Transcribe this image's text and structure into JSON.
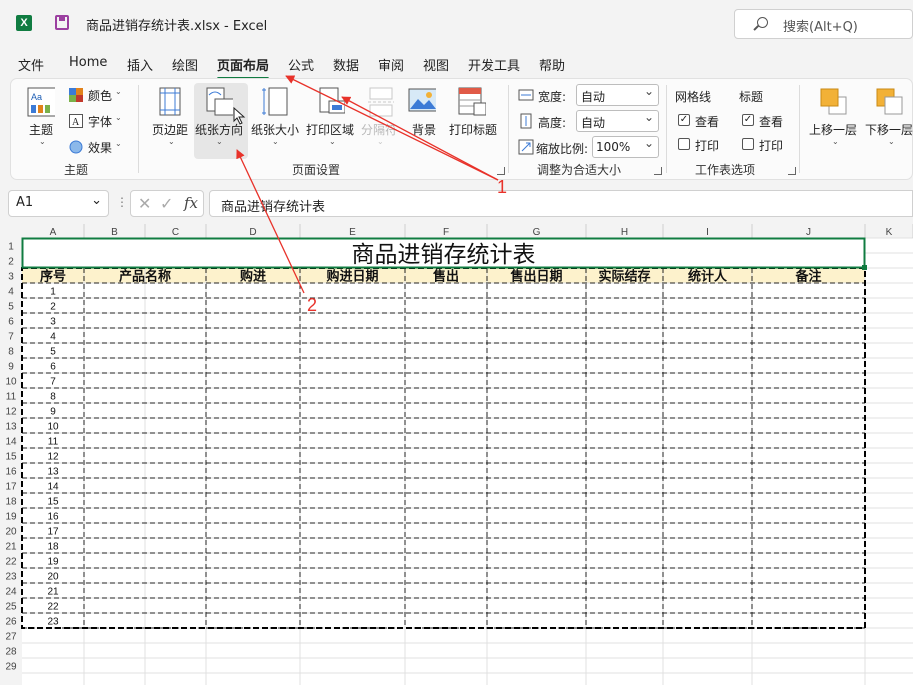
{
  "window": {
    "title": "商品进销存统计表.xlsx  -  Excel"
  },
  "search": {
    "placeholder": "搜索(Alt+Q)"
  },
  "menu": {
    "tabs": [
      "文件",
      "Home",
      "插入",
      "绘图",
      "页面布局",
      "公式",
      "数据",
      "审阅",
      "视图",
      "开发工具",
      "帮助"
    ],
    "active": "页面布局"
  },
  "ribbon": {
    "theme": {
      "themes": "主题",
      "colors": "颜色",
      "fonts": "字体",
      "effects": "效果",
      "group": "主题"
    },
    "page_setup": {
      "margins": "页边距",
      "orientation": "纸张方向",
      "size": "纸张大小",
      "print_area": "打印区域",
      "breaks": "分隔符",
      "background": "背景",
      "print_titles": "打印标题",
      "group": "页面设置"
    },
    "scale": {
      "width_label": "宽度:",
      "width_value": "自动",
      "height_label": "高度:",
      "height_value": "自动",
      "scale_label": "缩放比例:",
      "scale_value": "100%",
      "group": "调整为合适大小"
    },
    "sheet_options": {
      "gridlines": "网格线",
      "headings": "标题",
      "view": "查看",
      "print": "打印",
      "gridlines_view": true,
      "gridlines_print": false,
      "headings_view": true,
      "headings_print": false,
      "group": "工作表选项"
    },
    "arrange": {
      "bring_forward": "上移一层",
      "send_backward": "下移一层"
    }
  },
  "formula_bar": {
    "name_box": "A1",
    "fx": "fx",
    "content": "商品进销存统计表"
  },
  "sheet": {
    "columns": [
      "A",
      "B",
      "C",
      "D",
      "E",
      "F",
      "G",
      "H",
      "I",
      "J",
      "K"
    ],
    "rows": [
      "1",
      "2",
      "3",
      "4",
      "5",
      "6",
      "7",
      "8",
      "9",
      "10",
      "11",
      "12",
      "13",
      "14",
      "15",
      "16",
      "17",
      "18",
      "19",
      "20",
      "21",
      "22",
      "23",
      "24",
      "25",
      "26",
      "27",
      "28",
      "29"
    ],
    "title": "商品进销存统计表",
    "headers": [
      "序号",
      "产品名称",
      "购进",
      "购进日期",
      "售出",
      "售出日期",
      "实际结存",
      "统计人",
      "备注"
    ],
    "serials": [
      "1",
      "2",
      "3",
      "4",
      "5",
      "6",
      "7",
      "8",
      "9",
      "10",
      "11",
      "12",
      "13",
      "14",
      "15",
      "16",
      "17",
      "18",
      "19",
      "20",
      "21",
      "22",
      "23"
    ],
    "header_fill": "#fdf2cc",
    "page_break_color": "#000000"
  },
  "annotations": {
    "color": "#e8322a",
    "labels": [
      "1",
      "2"
    ]
  }
}
